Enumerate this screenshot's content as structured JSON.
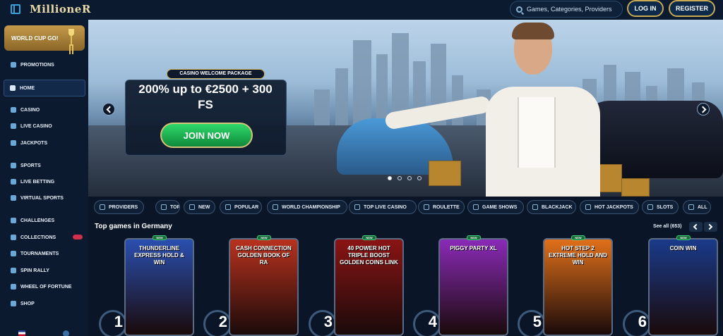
{
  "header": {
    "logo": "MillioneR",
    "search_placeholder": "Games, Categories, Providers",
    "login_label": "LOG IN",
    "register_label": "REGISTER"
  },
  "sidebar": {
    "promo_label": "WORLD CUP GO!",
    "items": [
      {
        "label": "PROMOTIONS",
        "icon": "megaphone-icon"
      },
      {
        "label": "HOME",
        "icon": "home-icon",
        "active": true
      },
      {
        "label": "CASINO",
        "icon": "spade-icon"
      },
      {
        "label": "LIVE CASINO",
        "icon": "dealer-icon"
      },
      {
        "label": "JACKPOTS",
        "icon": "coins-icon"
      },
      {
        "label": "SPORTS",
        "icon": "ball-icon"
      },
      {
        "label": "LIVE BETTING",
        "icon": "live-icon"
      },
      {
        "label": "VIRTUAL SPORTS",
        "icon": "joystick-icon"
      },
      {
        "label": "CHALLENGES",
        "icon": "swords-icon"
      },
      {
        "label": "COLLECTIONS",
        "icon": "cards-icon",
        "badge": true
      },
      {
        "label": "TOURNAMENTS",
        "icon": "trophy-icon"
      },
      {
        "label": "SPIN RALLY",
        "icon": "flag-icon"
      },
      {
        "label": "WHEEL OF FORTUNE",
        "icon": "wheel-icon"
      },
      {
        "label": "SHOP",
        "icon": "shop-icon"
      }
    ]
  },
  "banner": {
    "tag": "CASINO WELCOME PACKAGE",
    "title": "200% up to €2500 + 300 FS",
    "cta": "JOIN NOW",
    "slides_total": 4,
    "slide_active": 1
  },
  "categories": [
    "PROVIDERS",
    "TOP",
    "NEW",
    "POPULAR",
    "WORLD CHAMPIONSHIP",
    "TOP LIVE CASINO",
    "ROULETTE",
    "GAME SHOWS",
    "BLACKJACK",
    "HOT JACKPOTS",
    "SLOTS",
    "ALL"
  ],
  "games_section": {
    "title": "Top games in Germany",
    "see_all": "See all (653)",
    "new_tag": "NEW",
    "games": [
      {
        "rank": "1",
        "title": "THUNDERLINE EXPRESS HOLD & WIN",
        "bg": "#2a4fb0"
      },
      {
        "rank": "2",
        "title": "CASH CONNECTION GOLDEN BOOK OF RA",
        "bg": "#b8321e"
      },
      {
        "rank": "3",
        "title": "40 POWER HOT TRIPLE BOOST GOLDEN COINS LINK",
        "bg": "#8a1414"
      },
      {
        "rank": "4",
        "title": "PIGGY PARTY XL",
        "bg": "#8a2ab8"
      },
      {
        "rank": "5",
        "title": "HOT STEP 2 EXTREME HOLD AND WIN",
        "bg": "#e0701a"
      },
      {
        "rank": "6",
        "title": "COIN WIN",
        "bg": "#1a3a8a"
      }
    ]
  }
}
